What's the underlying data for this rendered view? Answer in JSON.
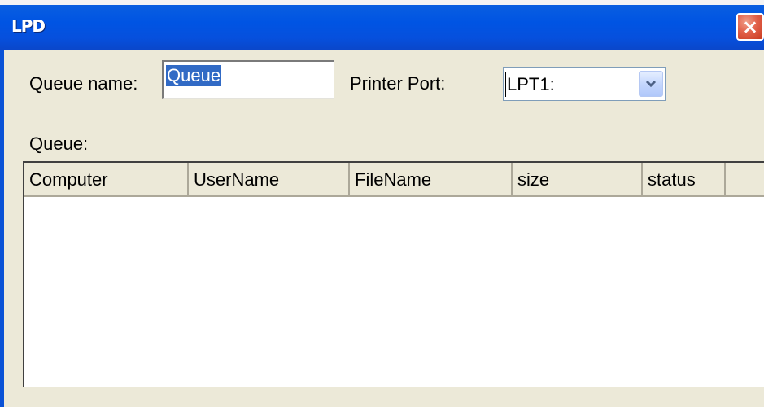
{
  "window": {
    "title": "LPD",
    "close_label": "×"
  },
  "form": {
    "queue_name_label": "Queue name:",
    "queue_name_value": "Queue",
    "printer_port_label": "Printer Port:",
    "printer_port_value": "LPT1:",
    "queue_label": "Queue:"
  },
  "queue_table": {
    "columns": [
      "Computer",
      "UserName",
      "FileName",
      "size",
      "status"
    ],
    "rows": []
  }
}
